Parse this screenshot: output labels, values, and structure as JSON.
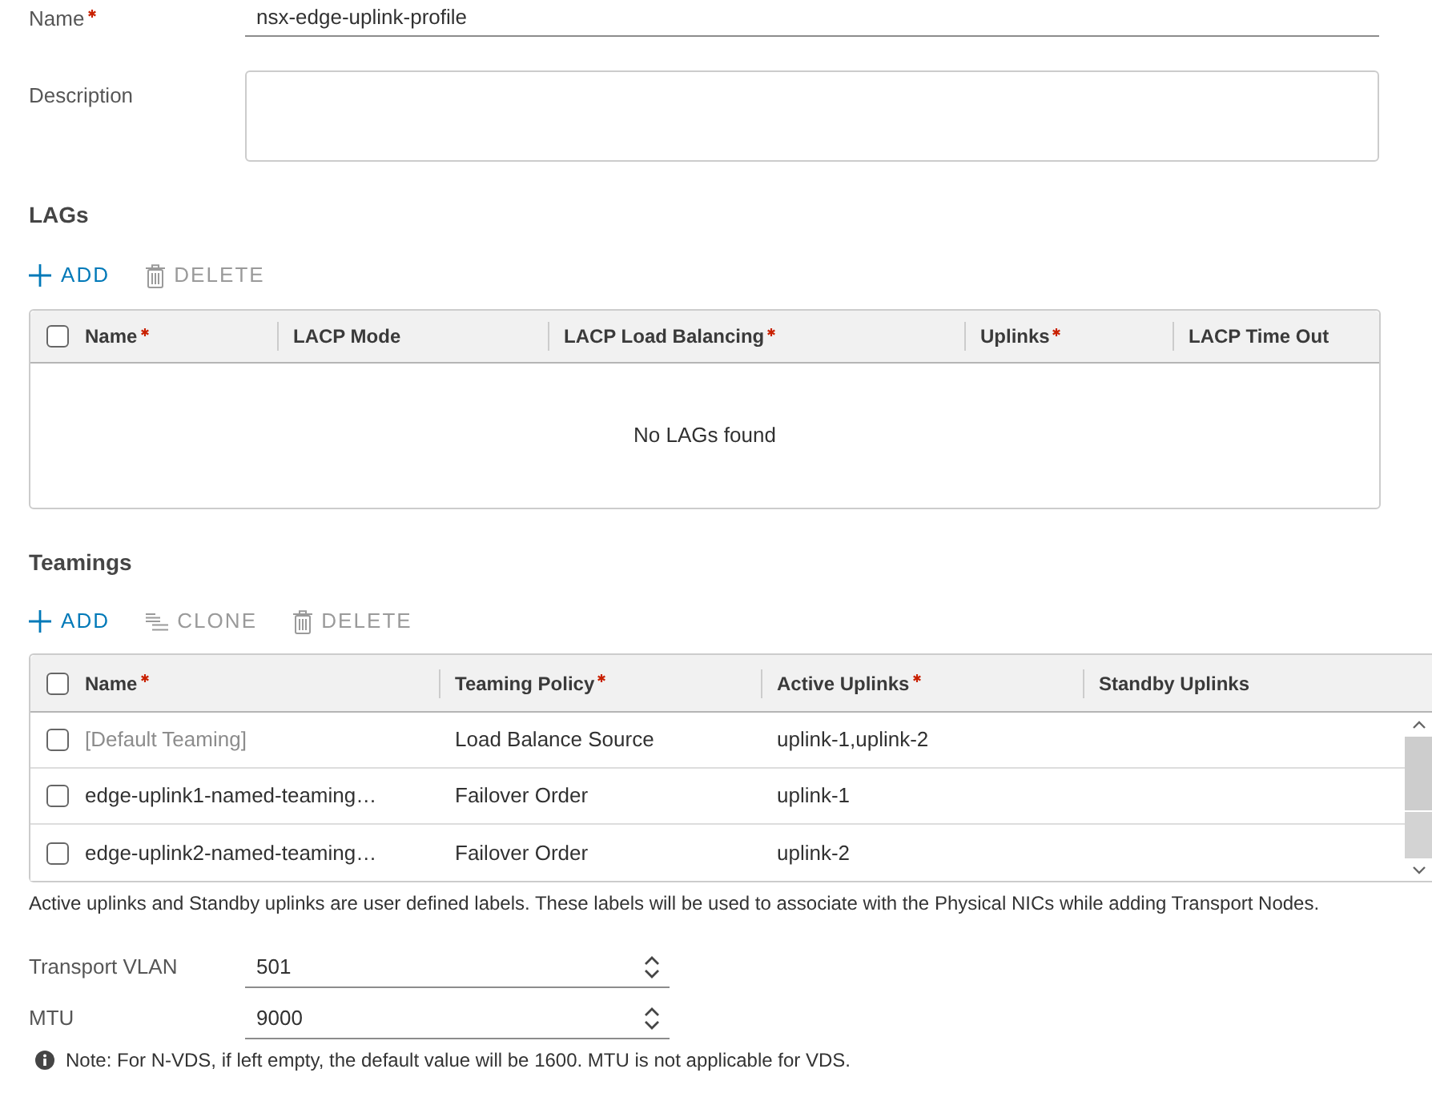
{
  "name_field": {
    "label": "Name",
    "required": true,
    "value": "nsx-edge-uplink-profile"
  },
  "description_field": {
    "label": "Description",
    "required": false
  },
  "lags": {
    "title": "LAGs",
    "toolbar": [
      {
        "label": "ADD",
        "kind": "add",
        "disabled": false
      },
      {
        "label": "DELETE",
        "kind": "delete",
        "disabled": true
      }
    ],
    "select_all": {
      "checked": false
    },
    "columns": [
      {
        "label": "Name",
        "required": true
      },
      {
        "label": "LACP Mode",
        "required": false
      },
      {
        "label": "LACP Load Balancing",
        "required": true
      },
      {
        "label": "Uplinks",
        "required": true
      },
      {
        "label": "LACP Time Out",
        "required": false
      }
    ],
    "empty_message": "No LAGs found"
  },
  "teamings": {
    "title": "Teamings",
    "toolbar": [
      {
        "label": "ADD",
        "kind": "add",
        "disabled": false
      },
      {
        "label": "CLONE",
        "kind": "clone",
        "disabled": true
      },
      {
        "label": "DELETE",
        "kind": "delete",
        "disabled": true
      }
    ],
    "select_all": {
      "checked": false
    },
    "columns": [
      {
        "label": "Name",
        "required": true
      },
      {
        "label": "Teaming Policy",
        "required": true
      },
      {
        "label": "Active Uplinks",
        "required": true
      },
      {
        "label": "Standby Uplinks",
        "required": false
      }
    ],
    "rows": [
      {
        "name": "[Default Teaming]",
        "disabled": true,
        "checked": false,
        "teaming_policy": "Load Balance Source",
        "active_uplinks": "uplink-1,uplink-2"
      },
      {
        "name": "edge-uplink1-named-teaming…",
        "disabled": false,
        "checked": false,
        "teaming_policy": "Failover Order",
        "active_uplinks": "uplink-1"
      },
      {
        "name": "edge-uplink2-named-teaming…",
        "disabled": false,
        "checked": false,
        "teaming_policy": "Failover Order",
        "active_uplinks": "uplink-2"
      }
    ]
  },
  "uplinks_hint": "Active uplinks and Standby uplinks are user defined labels. These labels will be used to associate with the Physical NICs while adding Transport Nodes.",
  "transport_vlan": {
    "label": "Transport VLAN",
    "value": "501"
  },
  "mtu": {
    "label": "MTU",
    "value": "9000"
  },
  "note": "Note: For N-VDS, if left empty, the default value will be 1600. MTU is not applicable for VDS."
}
